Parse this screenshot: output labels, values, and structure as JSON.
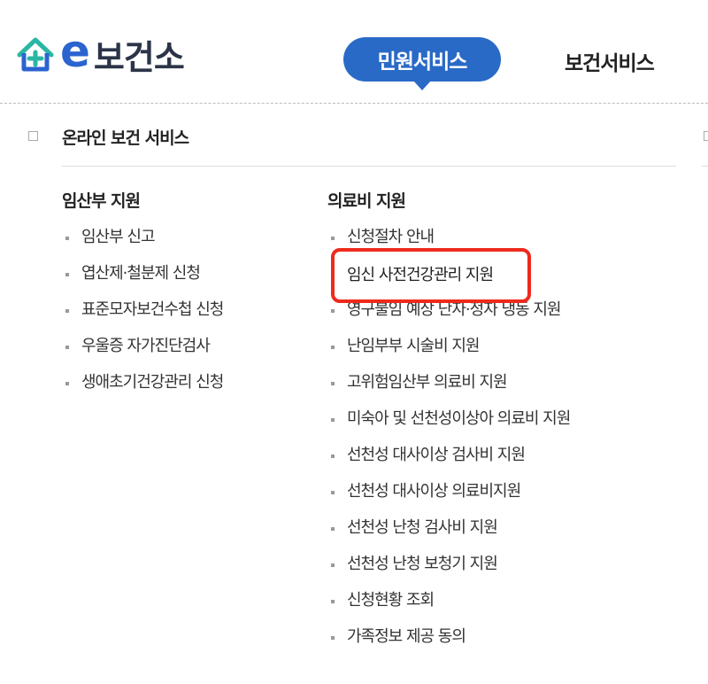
{
  "logo": {
    "letter": "e",
    "text": "보건소"
  },
  "nav": {
    "active": "민원서비스",
    "other": "보건서비스"
  },
  "section": {
    "title": "온라인 보건 서비스"
  },
  "left": {
    "title": "임산부 지원",
    "items": [
      "임산부 신고",
      "엽산제·철분제 신청",
      "표준모자보건수첩 신청",
      "우울증 자가진단검사",
      "생애초기건강관리 신청"
    ]
  },
  "right": {
    "title": "의료비 지원",
    "items": [
      "신청절차 안내",
      "임신 사전건강관리 지원",
      "영구불임 예상 난자·정자 냉동 지원",
      "난임부부 시술비 지원",
      "고위험임산부 의료비 지원",
      "미숙아 및 선천성이상아 의료비 지원",
      "선천성 대사이상 검사비 지원",
      "선천성 대사이상 의료비지원",
      "선천성 난청 검사비 지원",
      "선천성 난청 보청기 지원",
      "신청현황 조회",
      "가족정보 제공 동의"
    ]
  },
  "highlighted": "임신 사전건강관리 지원",
  "colors": {
    "brand": "#2a6ac7",
    "highlight_border": "#ee2a1c"
  }
}
